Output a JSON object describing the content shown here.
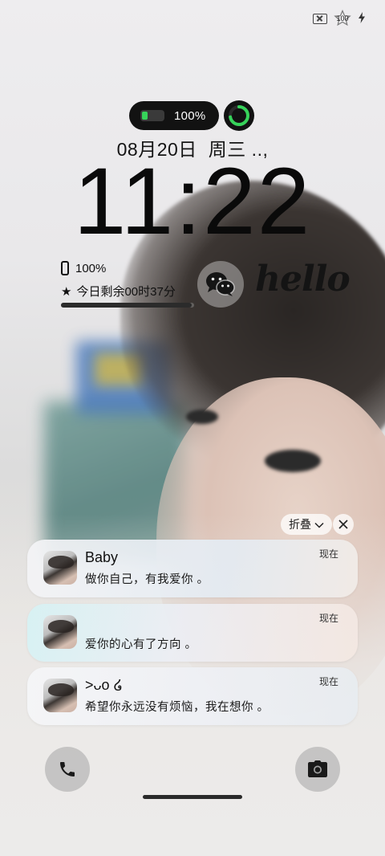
{
  "status_bar": {
    "battery_level": "100",
    "icons": [
      "sim-disabled-icon",
      "battery-star-icon",
      "charging-bolt-icon"
    ]
  },
  "capsule": {
    "battery_percent": "100%",
    "ring_progress": 0.72,
    "ring_color": "#36d35a"
  },
  "lock_screen": {
    "date": "08月20日",
    "weekday": "周三 ..,",
    "time": "11:22"
  },
  "widgets": {
    "phone_battery": "100%",
    "time_remaining": "今日剩余00时37分",
    "day_progress": 0.98,
    "wechat_icon": "wechat-icon",
    "signature": "hello"
  },
  "notification_group": {
    "fold_label": "折叠",
    "notifications": [
      {
        "sender": "Baby",
        "message": "做你自己，有我爱你 。",
        "time": "现在"
      },
      {
        "sender": "",
        "message": "爱你的心有了方向 。",
        "time": "现在"
      },
      {
        "sender": ">ᴗo ໒",
        "message": "希望你永远没有烦恼，我在想你 。",
        "time": "现在"
      }
    ]
  },
  "shortcuts": {
    "left_icon": "phone-icon",
    "right_icon": "camera-icon"
  }
}
